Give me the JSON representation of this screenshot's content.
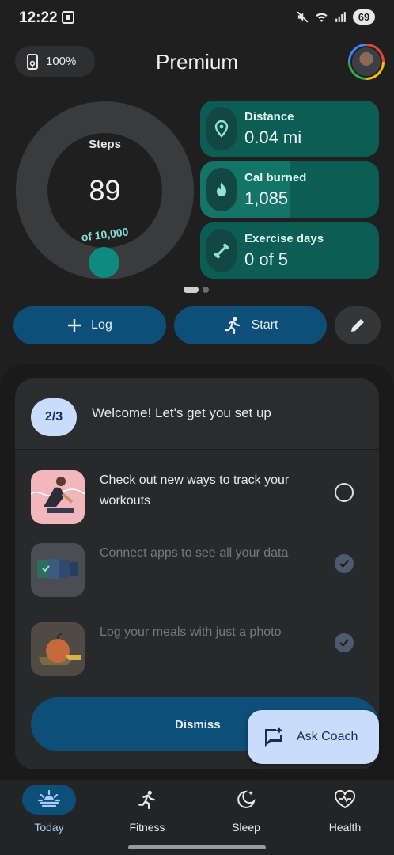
{
  "status_bar": {
    "time": "12:22",
    "battery": "69"
  },
  "header": {
    "battery_percent": "100%",
    "title": "Premium"
  },
  "steps": {
    "label": "Steps",
    "value": "89",
    "goal": "of 10,000",
    "progress_fraction": 0.0089
  },
  "stats": [
    {
      "label": "Distance",
      "value": "0.04 mi",
      "icon": "location-pin-icon"
    },
    {
      "label": "Cal burned",
      "value": "1,085",
      "icon": "flame-icon",
      "progress_fraction": 0.5
    },
    {
      "label": "Exercise days",
      "value": "0 of 5",
      "icon": "dumbbell-icon"
    }
  ],
  "actions": {
    "log_label": "Log",
    "start_label": "Start"
  },
  "setup": {
    "progress": "2/3",
    "title": "Welcome! Let's get you set up",
    "tasks": [
      {
        "text": "Check out new ways to track your workouts",
        "done": false
      },
      {
        "text": "Connect apps to see all your data",
        "done": true
      },
      {
        "text": "Log your meals with just a photo",
        "done": true
      }
    ],
    "dismiss_label": "Dismiss"
  },
  "ask_coach_label": "Ask Coach",
  "nav": [
    {
      "label": "Today",
      "icon": "sunrise-icon",
      "active": true
    },
    {
      "label": "Fitness",
      "icon": "running-person-icon",
      "active": false
    },
    {
      "label": "Sleep",
      "icon": "moon-stars-icon",
      "active": false
    },
    {
      "label": "Health",
      "icon": "heart-pulse-icon",
      "active": false
    }
  ],
  "colors": {
    "accent_blue": "#0e4f7a",
    "teal": "#0c5e55",
    "coach_bg": "#c9dcfb"
  }
}
